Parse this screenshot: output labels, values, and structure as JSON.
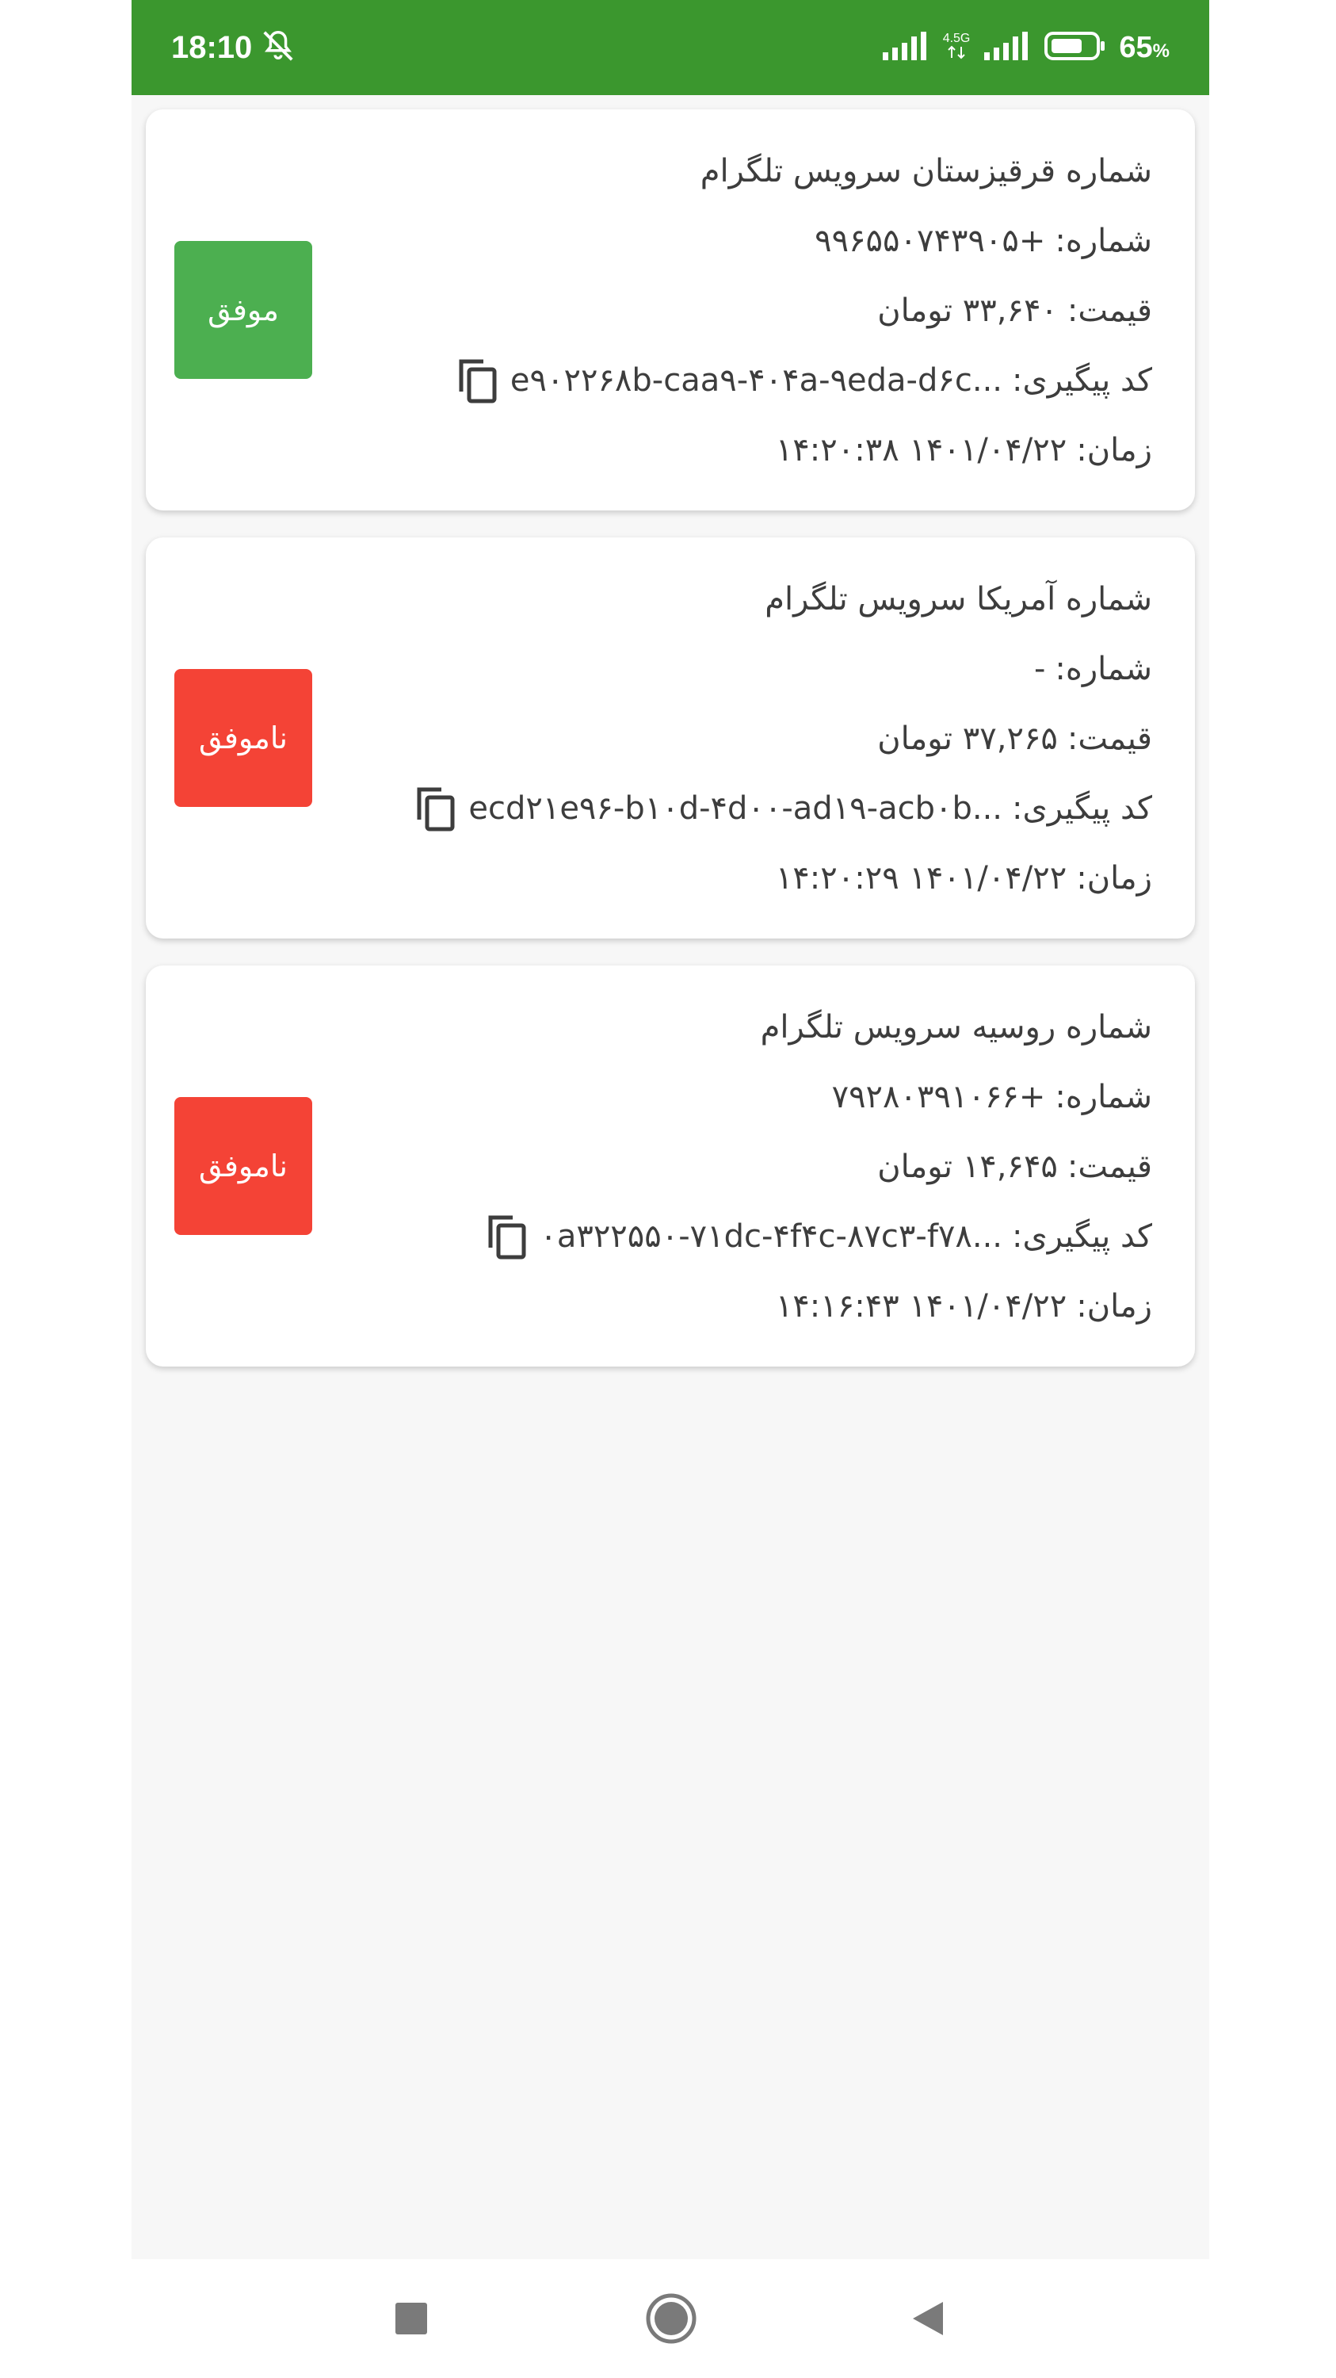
{
  "status_bar": {
    "time": "18:10",
    "network_label": "4.5G",
    "battery_percent": "65",
    "battery_unit": "%",
    "color": "#3b972e"
  },
  "colors": {
    "success": "#4caf50",
    "failure": "#f44336"
  },
  "orders": [
    {
      "title": "شماره قرقیزستان سرویس تلگرام",
      "number_label": "شماره:",
      "number_value": "+۹۹۶۵۵۰۷۴۳۹۰۵",
      "price_label": "قیمت:",
      "price_value": "۳۳,۶۴۰ تومان",
      "tracking_label": "کد پیگیری:",
      "tracking_value": "e۹۰۲۲۶۸b-caa۹-۴۰۴a-۹eda-d۶c...",
      "time_label": "زمان:",
      "time_value": "۱۴۰۱/۰۴/۲۲ ۱۴:۲۰:۳۸",
      "status_label": "موفق",
      "status": "success"
    },
    {
      "title": "شماره آمریکا سرویس تلگرام",
      "number_label": "شماره:",
      "number_value": "-",
      "price_label": "قیمت:",
      "price_value": "۳۷,۲۶۵ تومان",
      "tracking_label": "کد پیگیری:",
      "tracking_value": "ecd۲۱e۹۶-b۱۰d-۴d۰۰-ad۱۹-acb۰b...",
      "time_label": "زمان:",
      "time_value": "۱۴۰۱/۰۴/۲۲ ۱۴:۲۰:۲۹",
      "status_label": "ناموفق",
      "status": "failure"
    },
    {
      "title": "شماره روسیه سرویس تلگرام",
      "number_label": "شماره:",
      "number_value": "+۷۹۲۸۰۳۹۱۰۶۶",
      "price_label": "قیمت:",
      "price_value": "۱۴,۶۴۵ تومان",
      "tracking_label": "کد پیگیری:",
      "tracking_value": "۰a۳۲۲۵۵۰-۷۱dc-۴f۴c-۸۷c۳-f۷۸...",
      "time_label": "زمان:",
      "time_value": "۱۴۰۱/۰۴/۲۲ ۱۴:۱۶:۴۳",
      "status_label": "ناموفق",
      "status": "failure"
    }
  ],
  "nav": {
    "recents_icon": "square-icon",
    "home_icon": "circle-icon",
    "back_icon": "triangle-back-icon"
  }
}
